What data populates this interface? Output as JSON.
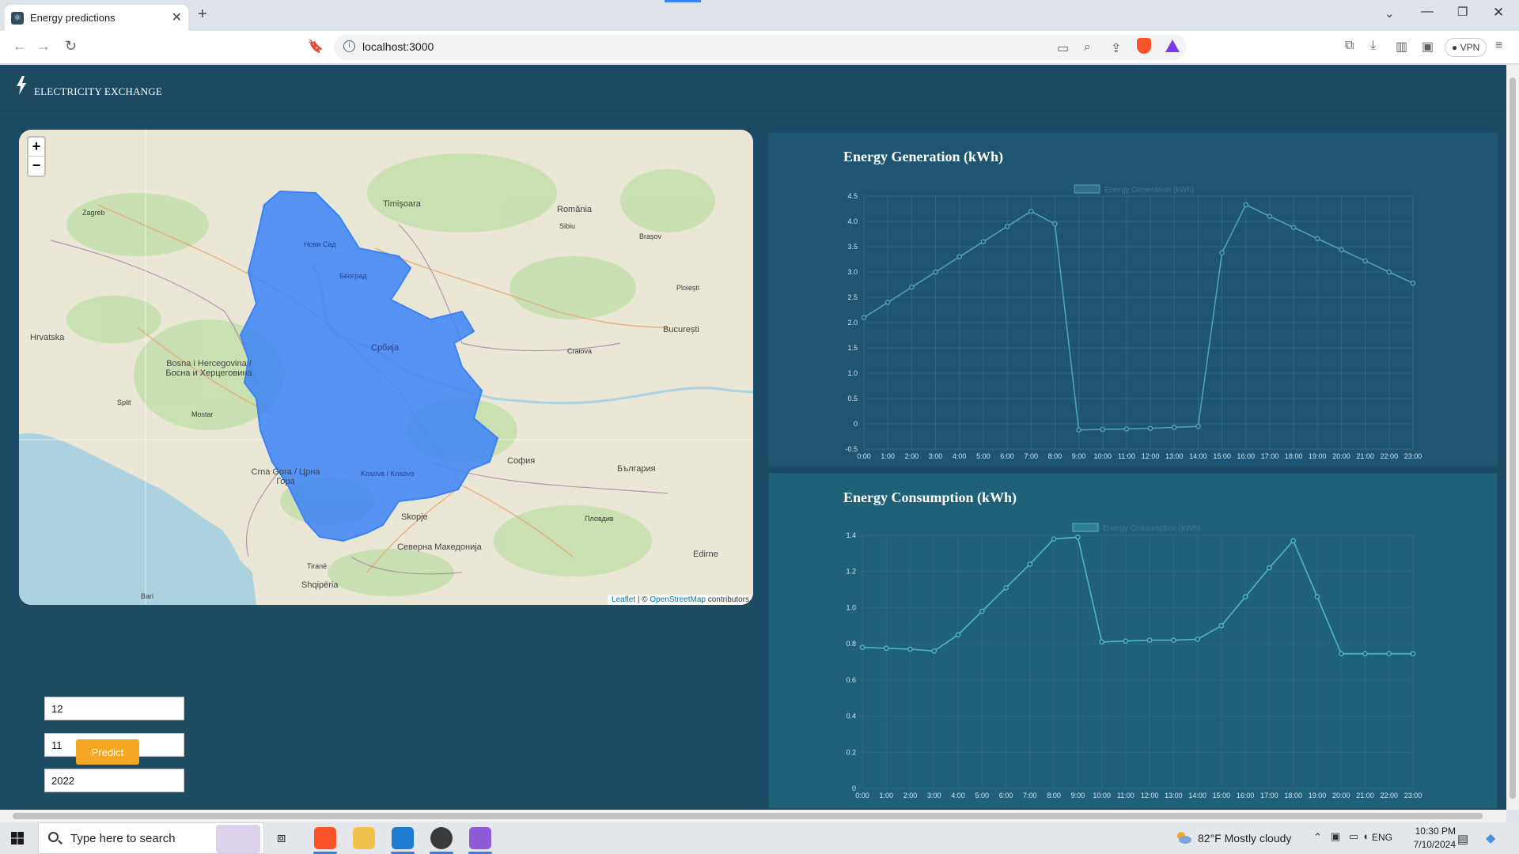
{
  "browser": {
    "tab_title": "Energy predictions",
    "url": "localhost:3000",
    "vpn_label": "VPN"
  },
  "header": {
    "brand": "ELECTRICITY EXCHANGE"
  },
  "map": {
    "zoom_in": "+",
    "zoom_out": "−",
    "attribution_leaflet": "Leaflet",
    "attribution_sep": " | © ",
    "attribution_osm": "OpenStreetMap",
    "attribution_tail": " contributors",
    "labels": {
      "zagreb": "Zagreb",
      "hrvatska": "Hrvatska",
      "bosna": "Bosna i Hercegovina / Босна и Херцеговина",
      "srbija": "Србија",
      "beograd": "Београд",
      "novi_sad": "Нови Сад",
      "timisoara": "Timișoara",
      "romania": "România",
      "bucuresti": "București",
      "crna_gora": "Crna Gora / Црна Гора",
      "kosovo": "Kosova / Kosovo",
      "sofia": "София",
      "bulgaria": "България",
      "skopje": "Skopje",
      "makedonija": "Северна Македонија",
      "shqiperia": "Shqipëria",
      "tirane": "Tiranë",
      "plovdiv": "Пловдив",
      "edirne": "Edirne",
      "brasov": "Brașov",
      "craiova": "Craiova",
      "ploiesti": "Ploiești",
      "split": "Split",
      "bari": "Bari",
      "mostar": "Mostar",
      "sibiu": "Sibiu"
    }
  },
  "form": {
    "day": "12",
    "month": "11",
    "year": "2022",
    "predict_label": "Predict"
  },
  "charts": {
    "generation_title": "Energy Generation (kWh)",
    "consumption_title": "Energy Consumption (kWh)"
  },
  "chart_data": [
    {
      "type": "line",
      "title": "Energy Generation (kWh)",
      "legend": "Energy Generation (kWh)",
      "color": "#4fa3b3",
      "categories": [
        "0:00",
        "1:00",
        "2:00",
        "3:00",
        "4:00",
        "5:00",
        "6:00",
        "7:00",
        "8:00",
        "9:00",
        "10:00",
        "11:00",
        "12:00",
        "13:00",
        "14:00",
        "15:00",
        "16:00",
        "17:00",
        "18:00",
        "19:00",
        "20:00",
        "21:00",
        "22:00",
        "23:00"
      ],
      "values": [
        2.1,
        2.4,
        2.7,
        3.0,
        3.3,
        3.6,
        3.9,
        4.2,
        3.95,
        -0.12,
        -0.11,
        -0.1,
        -0.09,
        -0.07,
        -0.05,
        3.38,
        4.33,
        4.1,
        3.88,
        3.66,
        3.44,
        3.22,
        3.0,
        2.78
      ],
      "ylim": [
        -0.5,
        4.5
      ],
      "yticks": [
        -0.5,
        0,
        0.5,
        1.0,
        1.5,
        2.0,
        2.5,
        3.0,
        3.5,
        4.0,
        4.5
      ],
      "ytick_labels": [
        "-0.5",
        "0",
        "0.5",
        "1.0",
        "1.5",
        "2.0",
        "2.5",
        "3.0",
        "3.5",
        "4.0",
        "4.5"
      ]
    },
    {
      "type": "line",
      "title": "Energy Consumption (kWh)",
      "legend": "Energy Consumption (kWh)",
      "color": "#4fb6c2",
      "categories": [
        "0:00",
        "1:00",
        "2:00",
        "3:00",
        "4:00",
        "5:00",
        "6:00",
        "7:00",
        "8:00",
        "9:00",
        "10:00",
        "11:00",
        "12:00",
        "13:00",
        "14:00",
        "15:00",
        "16:00",
        "17:00",
        "18:00",
        "19:00",
        "20:00",
        "21:00",
        "22:00",
        "23:00"
      ],
      "values": [
        0.78,
        0.775,
        0.77,
        0.76,
        0.85,
        0.98,
        1.11,
        1.24,
        1.38,
        1.39,
        0.81,
        0.815,
        0.82,
        0.82,
        0.825,
        0.9,
        1.06,
        1.22,
        1.37,
        1.06,
        0.745,
        0.745,
        0.745,
        0.745
      ],
      "ylim": [
        0,
        1.4
      ],
      "yticks": [
        0,
        0.2,
        0.4,
        0.6,
        0.8,
        1.0,
        1.2,
        1.4
      ],
      "ytick_labels": [
        "0",
        "0.2",
        "0.4",
        "0.6",
        "0.8",
        "1.0",
        "1.2",
        "1.4"
      ]
    }
  ],
  "taskbar": {
    "search_placeholder": "Type here to search",
    "weather": "82°F  Mostly cloudy",
    "lang": "ENG",
    "time": "10:30 PM",
    "date": "7/10/2024"
  }
}
